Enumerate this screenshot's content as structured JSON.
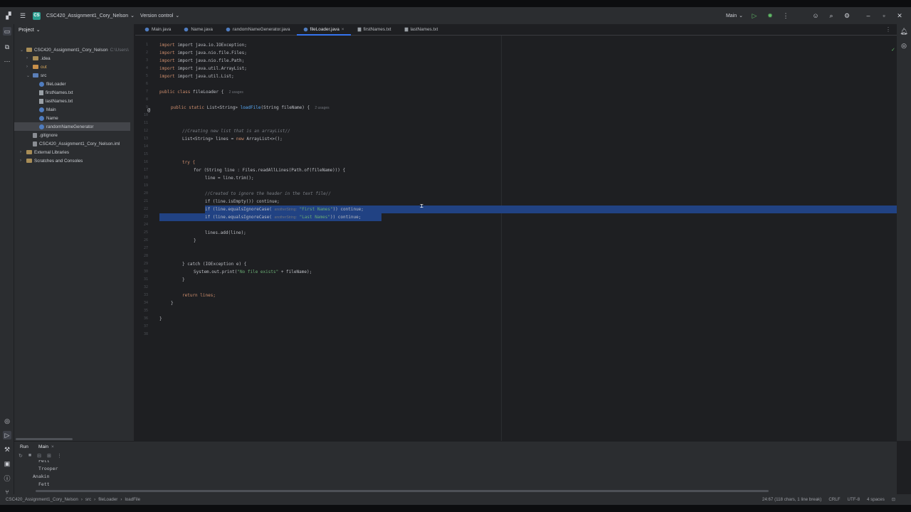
{
  "title_bar": {
    "project_badge": "CS",
    "project_name": "CSC420_Assignment1_Cory_Nelson",
    "version_control": "Version control",
    "run_config": "Main"
  },
  "project_panel": {
    "title": "Project",
    "tree": [
      {
        "label": "CSC420_Assignment1_Cory_Nelson",
        "suffix": "C:\\Users\\",
        "kind": "folder"
      },
      {
        "label": ".idea",
        "kind": "folder"
      },
      {
        "label": "out",
        "kind": "folder"
      },
      {
        "label": "src",
        "kind": "folder-blue"
      },
      {
        "label": "fileLoader",
        "kind": "class"
      },
      {
        "label": "firstNames.txt",
        "kind": "txt"
      },
      {
        "label": "lastNames.txt",
        "kind": "txt"
      },
      {
        "label": "Main",
        "kind": "class"
      },
      {
        "label": "Name",
        "kind": "class"
      },
      {
        "label": "randomNameGenerator",
        "kind": "class"
      },
      {
        "label": ".gitignore",
        "kind": "file"
      },
      {
        "label": "CSC420_Assignment1_Cory_Nelson.iml",
        "kind": "file"
      },
      {
        "label": "External Libraries",
        "kind": "lib"
      },
      {
        "label": "Scratches and Consoles",
        "kind": "lib"
      }
    ]
  },
  "tabs": [
    "Main.java",
    "Name.java",
    "randomNameGenerator.java",
    "fileLoader.java",
    "firstNames.txt",
    "lastNames.txt"
  ],
  "active_tab": "fileLoader.java",
  "code": {
    "l1": "import java.io.IOException;",
    "l2": "import java.nio.file.Files;",
    "l3": "import java.nio.file.Path;",
    "l4": "import java.util.ArrayList;",
    "l5": "import java.util.List;",
    "class_kw": "public class",
    "class_name": "fileLoader {",
    "class_usages": "2 usages",
    "method_kw": "public static",
    "method_type": "List<String>",
    "method_name": "loadFile",
    "method_params": "(String fileName) {",
    "method_usages": "2 usages",
    "c1": "//Creating new list that is an arrayList//",
    "l_list": "List<String> lines = ",
    "l_list_kw": "new",
    "l_list_end": " ArrayList<>();",
    "try_kw": "try {",
    "for_line": "for (String line : Files.readAllLines(Path.of(fileName))) {",
    "trim_line": "line = line.trim();",
    "c2": "//Created to ignore the header in the text file//",
    "empty_line": "if (line.isEmpty()) continue;",
    "eq1_pre": "if (line.equalsIgnoreCase(",
    "eq_hint": "anotherString:",
    "eq1_str": "\"First Names\"",
    "eq1_post": ")) continue;",
    "eq2_pre": "if (line.equalsIgnoreCase(",
    "eq2_str": "\"Last Names\"",
    "eq2_post": ")) continue;",
    "add_line": "lines.add(line);",
    "close1": "}",
    "catch_line": "} catch (IOException e) {",
    "print_pre": "System.out.print(",
    "print_str": "\"No file exists\"",
    "print_post": " + fileName);",
    "close2": "}",
    "return_line": "return lines;",
    "close3": "}",
    "close4": "}"
  },
  "gutter_numbers": [
    "1",
    "2",
    "3",
    "4",
    "5",
    "6",
    "7",
    "8",
    "9",
    "10",
    "11",
    "12",
    "13",
    "14",
    "15",
    "16",
    "17",
    "18",
    "19",
    "20",
    "21",
    "22",
    "23",
    "24",
    "25",
    "26",
    "27",
    "28",
    "29",
    "30",
    "31",
    "32",
    "33",
    "34",
    "35",
    "36",
    "37",
    "38"
  ],
  "run_panel": {
    "tab_label": "Run",
    "config_tab": "Main",
    "output": [
      "Fett",
      "Trooper",
      "Anakin",
      "Fett"
    ]
  },
  "status_bar": {
    "breadcrumb": [
      "CSC420_Assignment1_Cory_Nelson",
      "src",
      "fileLoader",
      "loadFile"
    ],
    "position": "24:67 (118 chars, 1 line break)",
    "line_sep": "CRLF",
    "encoding": "UTF-8",
    "indent": "4 spaces"
  }
}
